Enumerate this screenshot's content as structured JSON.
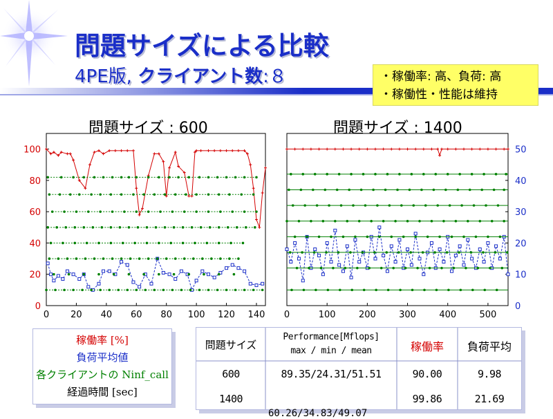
{
  "slide": {
    "title": "問題サイズによる比較",
    "subtitle_prefix": "4PE版,",
    "subtitle_strong": "クライアント数",
    "subtitle_suffix": ":８",
    "notes": [
      "・稼働率: 高、負荷: 高",
      "・稼働性・性能は維持"
    ],
    "accent_color": "#1a2ec8",
    "note_bg_color": "#ffff66"
  },
  "legend": {
    "items": [
      {
        "label": "稼働率 [%]",
        "color": "#d40000"
      },
      {
        "label": "負荷平均値",
        "color": "#1a2ec8"
      },
      {
        "label": "各クライアントの Ninf_call",
        "color": "#008000"
      },
      {
        "label": "経過時間 [sec]",
        "color": "#000000"
      }
    ]
  },
  "table": {
    "headers": [
      "問題サイズ",
      "Performance[Mflops]",
      "max / min / mean",
      "稼働率",
      "負荷平均"
    ],
    "rows": [
      {
        "size": "600",
        "perf": "89.35/24.31/51.51",
        "util": "90.00",
        "load": "9.98"
      },
      {
        "size": "1400",
        "perf": "",
        "util": "99.86",
        "load": "21.69"
      }
    ],
    "overflow_text": "60.26/34.83/49.07"
  },
  "chart_data": [
    {
      "type": "line",
      "title": "問題サイズ : 600",
      "xlabel": "",
      "ylabel": "",
      "xlim": [
        0,
        146
      ],
      "ylim": [
        0,
        110
      ],
      "xticks": [
        0,
        20,
        40,
        60,
        80,
        100,
        120,
        140
      ],
      "yticks": [
        0,
        20,
        40,
        60,
        80,
        100
      ],
      "grid": false,
      "series": [
        {
          "role": "utilization",
          "color": "#d40000",
          "x": [
            0,
            3,
            5,
            8,
            10,
            14,
            16,
            18,
            22,
            26,
            29,
            32,
            35,
            38,
            42,
            46,
            50,
            54,
            58,
            60,
            62,
            64,
            68,
            72,
            75,
            78,
            80,
            82,
            86,
            88,
            92,
            95,
            97,
            99,
            100,
            103,
            108,
            112,
            116,
            120,
            124,
            128,
            132,
            134,
            136,
            138,
            140,
            142,
            144,
            146
          ],
          "y": [
            100,
            97,
            98,
            96,
            98,
            97,
            97,
            93,
            80,
            75,
            90,
            98,
            99,
            97,
            99,
            99,
            99,
            99,
            99,
            75,
            58,
            62,
            83,
            97,
            97,
            92,
            70,
            88,
            98,
            89,
            85,
            70,
            70,
            98,
            99,
            99,
            99,
            99,
            99,
            99,
            99,
            99,
            99,
            97,
            90,
            75,
            55,
            50,
            72,
            88
          ]
        },
        {
          "role": "load",
          "color": "#1a2ec8",
          "x": [
            1,
            3,
            5,
            8,
            11,
            14,
            18,
            22,
            25,
            28,
            31,
            35,
            38,
            42,
            46,
            50,
            54,
            58,
            62,
            66,
            70,
            74,
            78,
            82,
            86,
            90,
            94,
            97,
            100,
            104,
            108,
            112,
            116,
            120,
            124,
            128,
            132,
            136,
            140,
            144
          ],
          "y": [
            27,
            20,
            16,
            19,
            17,
            22,
            20,
            17,
            20,
            12,
            10,
            14,
            22,
            22,
            20,
            28,
            26,
            15,
            12,
            20,
            14,
            30,
            21,
            20,
            17,
            22,
            20,
            10,
            16,
            22,
            20,
            18,
            21,
            24,
            26,
            24,
            22,
            14,
            13,
            14
          ]
        },
        {
          "role": "ninf_call",
          "color": "#008000",
          "level": 82,
          "x": [
            1,
            10,
            18,
            25,
            32,
            38,
            44,
            50,
            55,
            60,
            68,
            75,
            82,
            88,
            95,
            102,
            108,
            114,
            120,
            126,
            132,
            140
          ]
        },
        {
          "role": "ninf_call",
          "color": "#008000",
          "level": 71,
          "x": [
            2,
            9,
            16,
            22,
            30,
            36,
            43,
            50,
            58,
            65,
            72,
            79,
            86,
            93,
            100,
            108,
            115,
            122,
            130,
            138
          ]
        },
        {
          "role": "ninf_call",
          "color": "#008000",
          "level": 60,
          "x": [
            4,
            12,
            20,
            28,
            36,
            44,
            52,
            60,
            68,
            76,
            84,
            92,
            100,
            108,
            116,
            124,
            132,
            140
          ]
        },
        {
          "role": "ninf_call",
          "color": "#008000",
          "level": 50,
          "x": [
            1,
            7,
            13,
            19,
            25,
            31,
            37,
            43,
            49,
            55,
            61,
            67,
            73,
            79,
            85,
            91,
            97,
            103,
            109,
            115,
            121,
            127,
            133,
            139
          ]
        },
        {
          "role": "ninf_call",
          "color": "#008000",
          "level": 40,
          "x": [
            3,
            11,
            19,
            27,
            35,
            43,
            51,
            59,
            67,
            75,
            83,
            91,
            99,
            107,
            115,
            123,
            131
          ]
        },
        {
          "role": "ninf_call",
          "color": "#008000",
          "level": 30,
          "x": [
            2,
            8,
            14,
            20,
            26,
            32,
            38,
            44,
            50,
            56,
            62,
            68,
            74,
            80,
            86,
            92,
            98,
            104,
            110,
            116,
            122,
            128
          ]
        },
        {
          "role": "ninf_call",
          "color": "#008000",
          "level": 20,
          "x": [
            5,
            15,
            25,
            35,
            45,
            55,
            65,
            75,
            85,
            95,
            105,
            115,
            125
          ]
        },
        {
          "role": "ninf_call",
          "color": "#008000",
          "level": 10,
          "x": [
            0,
            6,
            12,
            18,
            24,
            30,
            36,
            42,
            48,
            54,
            60,
            66,
            72,
            78,
            84,
            90,
            96,
            102,
            108,
            114,
            120,
            126,
            132,
            138,
            144
          ]
        }
      ]
    },
    {
      "type": "line",
      "title": "問題サイズ : 1400",
      "xlabel": "",
      "ylabel": "",
      "xlim": [
        0,
        550
      ],
      "ylim": [
        0,
        55
      ],
      "xticks": [
        0,
        100,
        200,
        300,
        400,
        500
      ],
      "yticks": [
        0,
        10,
        20,
        30,
        40,
        50
      ],
      "grid": false,
      "series": [
        {
          "role": "utilization",
          "color": "#d40000",
          "x": [
            0,
            20,
            40,
            60,
            80,
            100,
            120,
            140,
            160,
            180,
            200,
            220,
            240,
            260,
            280,
            300,
            320,
            340,
            360,
            375,
            380,
            385,
            400,
            420,
            440,
            460,
            480,
            500,
            520,
            540,
            550
          ],
          "y": [
            50,
            50,
            50,
            50,
            50,
            50,
            50,
            50,
            50,
            50,
            50,
            50,
            50,
            50,
            50,
            50,
            50,
            50,
            50,
            50,
            48,
            50,
            50,
            50,
            50,
            50,
            50,
            50,
            50,
            50,
            50
          ]
        },
        {
          "role": "load",
          "color": "#1a2ec8",
          "x": [
            0,
            10,
            20,
            30,
            40,
            50,
            60,
            70,
            80,
            90,
            100,
            110,
            120,
            130,
            140,
            150,
            160,
            170,
            180,
            190,
            200,
            210,
            220,
            230,
            240,
            250,
            260,
            270,
            280,
            290,
            300,
            310,
            320,
            330,
            340,
            350,
            360,
            370,
            380,
            390,
            400,
            410,
            420,
            430,
            440,
            450,
            460,
            470,
            480,
            490,
            500,
            510,
            520,
            530,
            540,
            550
          ],
          "y": [
            18,
            14,
            20,
            15,
            8,
            22,
            12,
            18,
            16,
            10,
            20,
            14,
            24,
            13,
            11,
            19,
            9,
            21,
            14,
            17,
            12,
            22,
            15,
            25,
            16,
            11,
            19,
            14,
            21,
            12,
            18,
            13,
            23,
            15,
            10,
            17,
            20,
            12,
            18,
            14,
            22,
            11,
            16,
            19,
            13,
            21,
            15,
            12,
            18,
            14,
            20,
            12,
            19,
            15,
            22,
            10
          ]
        },
        {
          "role": "ninf_call",
          "color": "#008000",
          "level": 42,
          "x": [
            10,
            40,
            70,
            100,
            130,
            160,
            190,
            220,
            250,
            280,
            310,
            340,
            370,
            400,
            430,
            460,
            490,
            520,
            545
          ]
        },
        {
          "role": "ninf_call",
          "color": "#008000",
          "level": 37,
          "x": [
            5,
            35,
            65,
            95,
            125,
            155,
            185,
            215,
            245,
            275,
            305,
            335,
            365,
            395,
            425,
            455,
            485,
            515,
            540
          ]
        },
        {
          "role": "ninf_call",
          "color": "#008000",
          "level": 32,
          "x": [
            15,
            45,
            75,
            105,
            135,
            165,
            195,
            225,
            255,
            285,
            315,
            345,
            375,
            405,
            435,
            465,
            495,
            525
          ]
        },
        {
          "role": "ninf_call",
          "color": "#008000",
          "level": 27,
          "x": [
            0,
            30,
            60,
            90,
            120,
            150,
            180,
            210,
            240,
            270,
            300,
            330,
            360,
            390,
            420,
            450,
            480,
            510,
            540
          ]
        },
        {
          "role": "ninf_call",
          "color": "#008000",
          "level": 22,
          "x": [
            20,
            50,
            80,
            110,
            140,
            170,
            200,
            230,
            260,
            290,
            320,
            350,
            380,
            410,
            440,
            470,
            500,
            530
          ]
        },
        {
          "role": "ninf_call",
          "color": "#008000",
          "level": 17,
          "x": [
            8,
            38,
            68,
            98,
            128,
            158,
            188,
            218,
            248,
            278,
            308,
            338,
            368,
            398,
            428,
            458,
            488,
            518,
            548
          ]
        },
        {
          "role": "ninf_call",
          "color": "#008000",
          "level": 12,
          "x": [
            25,
            55,
            85,
            115,
            145,
            175,
            205,
            235,
            265,
            295,
            325,
            355,
            385,
            415,
            445,
            475,
            505,
            535
          ]
        },
        {
          "role": "ninf_call",
          "color": "#008000",
          "level": 5,
          "x": [
            12,
            42,
            72,
            102,
            132,
            162,
            192,
            222,
            252,
            282,
            312,
            342,
            372,
            402,
            432,
            462,
            492,
            522
          ]
        }
      ]
    }
  ]
}
